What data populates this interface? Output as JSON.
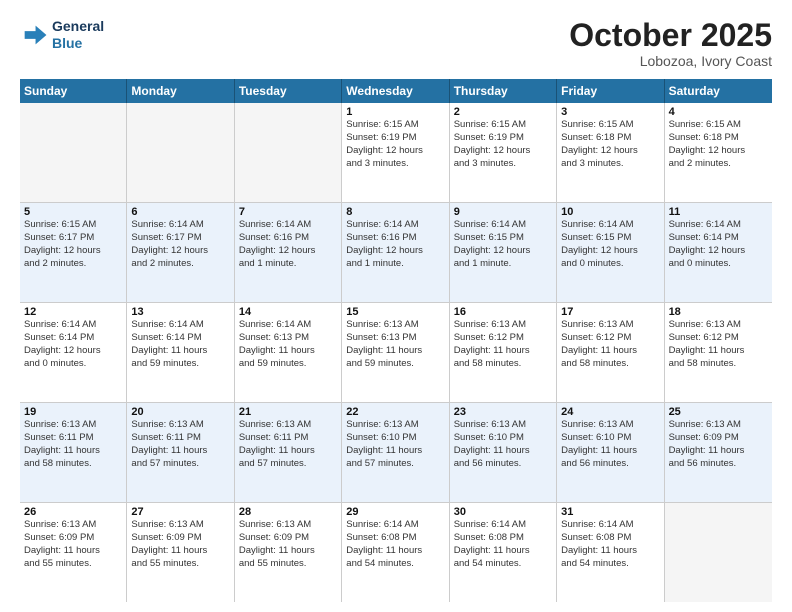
{
  "header": {
    "logo_line1": "General",
    "logo_line2": "Blue",
    "month": "October 2025",
    "location": "Lobozoa, Ivory Coast"
  },
  "weekdays": [
    "Sunday",
    "Monday",
    "Tuesday",
    "Wednesday",
    "Thursday",
    "Friday",
    "Saturday"
  ],
  "rows": [
    [
      {
        "num": "",
        "info": "",
        "empty": true
      },
      {
        "num": "",
        "info": "",
        "empty": true
      },
      {
        "num": "",
        "info": "",
        "empty": true
      },
      {
        "num": "1",
        "info": "Sunrise: 6:15 AM\nSunset: 6:19 PM\nDaylight: 12 hours\nand 3 minutes."
      },
      {
        "num": "2",
        "info": "Sunrise: 6:15 AM\nSunset: 6:19 PM\nDaylight: 12 hours\nand 3 minutes."
      },
      {
        "num": "3",
        "info": "Sunrise: 6:15 AM\nSunset: 6:18 PM\nDaylight: 12 hours\nand 3 minutes."
      },
      {
        "num": "4",
        "info": "Sunrise: 6:15 AM\nSunset: 6:18 PM\nDaylight: 12 hours\nand 2 minutes."
      }
    ],
    [
      {
        "num": "5",
        "info": "Sunrise: 6:15 AM\nSunset: 6:17 PM\nDaylight: 12 hours\nand 2 minutes."
      },
      {
        "num": "6",
        "info": "Sunrise: 6:14 AM\nSunset: 6:17 PM\nDaylight: 12 hours\nand 2 minutes."
      },
      {
        "num": "7",
        "info": "Sunrise: 6:14 AM\nSunset: 6:16 PM\nDaylight: 12 hours\nand 1 minute."
      },
      {
        "num": "8",
        "info": "Sunrise: 6:14 AM\nSunset: 6:16 PM\nDaylight: 12 hours\nand 1 minute."
      },
      {
        "num": "9",
        "info": "Sunrise: 6:14 AM\nSunset: 6:15 PM\nDaylight: 12 hours\nand 1 minute."
      },
      {
        "num": "10",
        "info": "Sunrise: 6:14 AM\nSunset: 6:15 PM\nDaylight: 12 hours\nand 0 minutes."
      },
      {
        "num": "11",
        "info": "Sunrise: 6:14 AM\nSunset: 6:14 PM\nDaylight: 12 hours\nand 0 minutes."
      }
    ],
    [
      {
        "num": "12",
        "info": "Sunrise: 6:14 AM\nSunset: 6:14 PM\nDaylight: 12 hours\nand 0 minutes."
      },
      {
        "num": "13",
        "info": "Sunrise: 6:14 AM\nSunset: 6:14 PM\nDaylight: 11 hours\nand 59 minutes."
      },
      {
        "num": "14",
        "info": "Sunrise: 6:14 AM\nSunset: 6:13 PM\nDaylight: 11 hours\nand 59 minutes."
      },
      {
        "num": "15",
        "info": "Sunrise: 6:13 AM\nSunset: 6:13 PM\nDaylight: 11 hours\nand 59 minutes."
      },
      {
        "num": "16",
        "info": "Sunrise: 6:13 AM\nSunset: 6:12 PM\nDaylight: 11 hours\nand 58 minutes."
      },
      {
        "num": "17",
        "info": "Sunrise: 6:13 AM\nSunset: 6:12 PM\nDaylight: 11 hours\nand 58 minutes."
      },
      {
        "num": "18",
        "info": "Sunrise: 6:13 AM\nSunset: 6:12 PM\nDaylight: 11 hours\nand 58 minutes."
      }
    ],
    [
      {
        "num": "19",
        "info": "Sunrise: 6:13 AM\nSunset: 6:11 PM\nDaylight: 11 hours\nand 58 minutes."
      },
      {
        "num": "20",
        "info": "Sunrise: 6:13 AM\nSunset: 6:11 PM\nDaylight: 11 hours\nand 57 minutes."
      },
      {
        "num": "21",
        "info": "Sunrise: 6:13 AM\nSunset: 6:11 PM\nDaylight: 11 hours\nand 57 minutes."
      },
      {
        "num": "22",
        "info": "Sunrise: 6:13 AM\nSunset: 6:10 PM\nDaylight: 11 hours\nand 57 minutes."
      },
      {
        "num": "23",
        "info": "Sunrise: 6:13 AM\nSunset: 6:10 PM\nDaylight: 11 hours\nand 56 minutes."
      },
      {
        "num": "24",
        "info": "Sunrise: 6:13 AM\nSunset: 6:10 PM\nDaylight: 11 hours\nand 56 minutes."
      },
      {
        "num": "25",
        "info": "Sunrise: 6:13 AM\nSunset: 6:09 PM\nDaylight: 11 hours\nand 56 minutes."
      }
    ],
    [
      {
        "num": "26",
        "info": "Sunrise: 6:13 AM\nSunset: 6:09 PM\nDaylight: 11 hours\nand 55 minutes."
      },
      {
        "num": "27",
        "info": "Sunrise: 6:13 AM\nSunset: 6:09 PM\nDaylight: 11 hours\nand 55 minutes."
      },
      {
        "num": "28",
        "info": "Sunrise: 6:13 AM\nSunset: 6:09 PM\nDaylight: 11 hours\nand 55 minutes."
      },
      {
        "num": "29",
        "info": "Sunrise: 6:14 AM\nSunset: 6:08 PM\nDaylight: 11 hours\nand 54 minutes."
      },
      {
        "num": "30",
        "info": "Sunrise: 6:14 AM\nSunset: 6:08 PM\nDaylight: 11 hours\nand 54 minutes."
      },
      {
        "num": "31",
        "info": "Sunrise: 6:14 AM\nSunset: 6:08 PM\nDaylight: 11 hours\nand 54 minutes."
      },
      {
        "num": "",
        "info": "",
        "empty": true
      }
    ]
  ]
}
